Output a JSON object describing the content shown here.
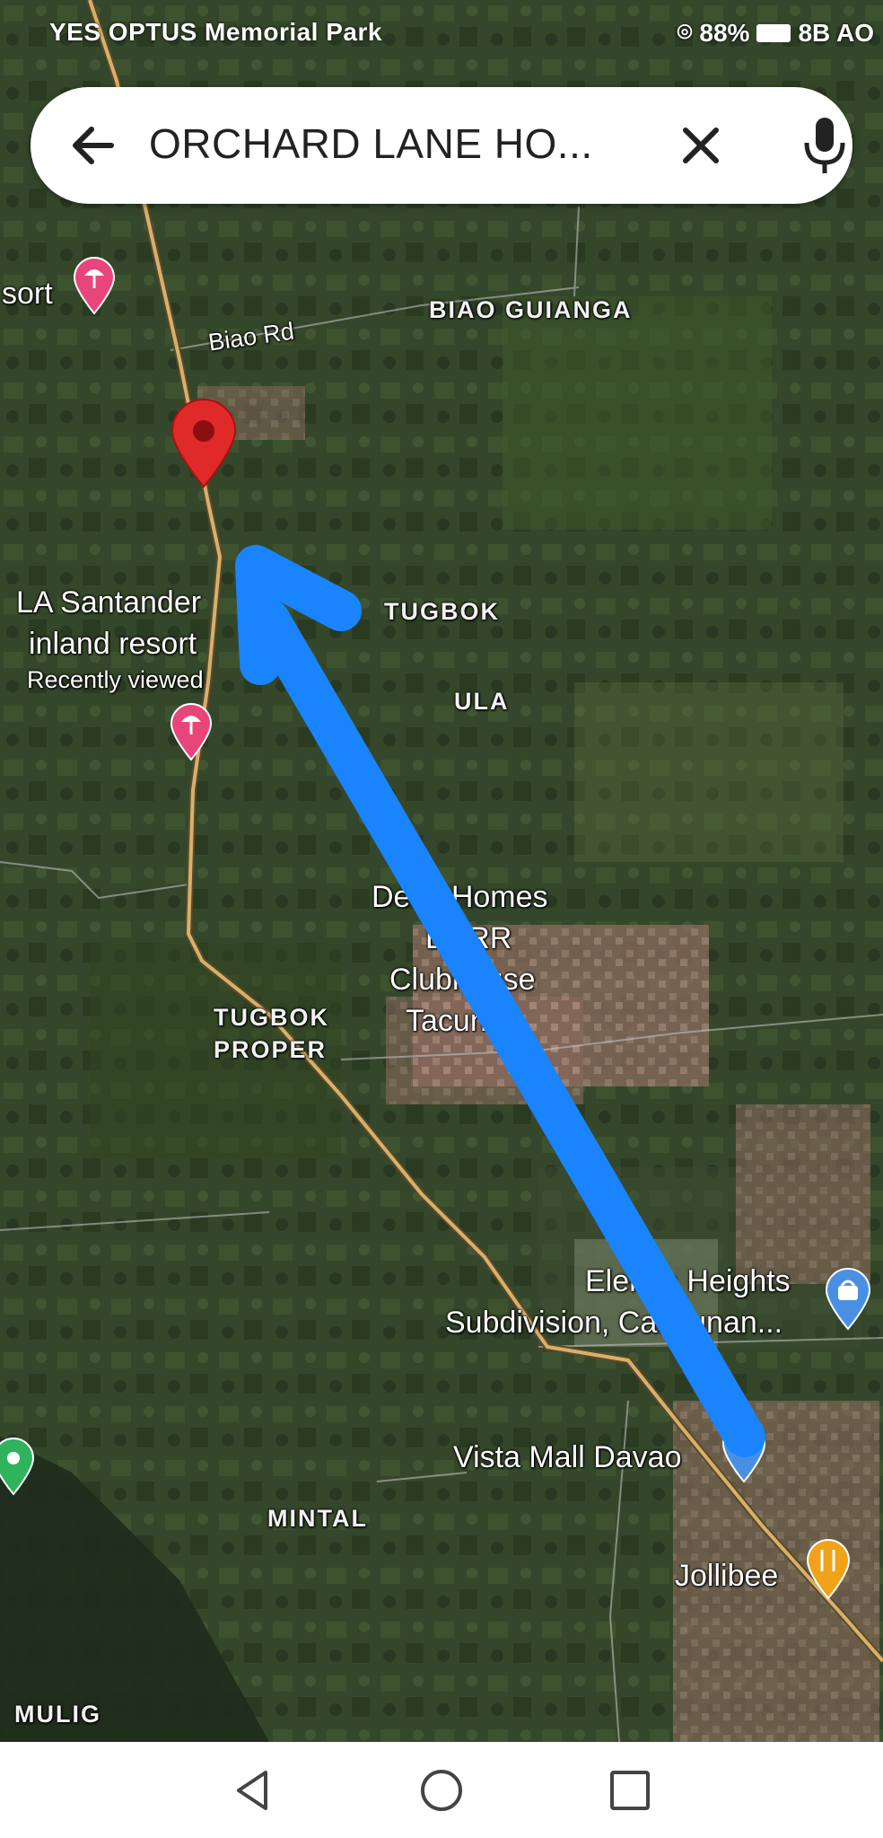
{
  "status_bar": {
    "left_text": "YES OPTUS  Memorial Park",
    "right_text": "88%",
    "right_extra": "8B AO"
  },
  "search": {
    "query": "ORCHARD LANE HO...",
    "icons": [
      "back-arrow-icon",
      "clear-icon",
      "microphone-icon"
    ]
  },
  "map": {
    "labels": {
      "resort_partial": "sort",
      "biao_rd": "Biao Rd",
      "biao_guianga": "BIAO GUIANGA",
      "la_santander_1": "LA Santander",
      "la_santander_2": "inland resort",
      "recently_viewed": "Recently viewed",
      "tugbok": "TUGBOK",
      "ula": "ULA",
      "deca_1": "Deca Homes",
      "deca_2": "DARR",
      "deca_3": "Clubhouse",
      "deca_4": "Tacunan",
      "tugbok_proper_1": "TUGBOK",
      "tugbok_proper_2": "PROPER",
      "elenita_1": "Elenita Heights",
      "elenita_2": "Subdivision, Catalunan...",
      "vista_mall": "Vista Mall Davao",
      "mintal": "MINTAL",
      "jollibee": "Jollibee",
      "mulig": "MULIG"
    },
    "arrow_color": "#1a84ff",
    "pin_color": "#e02a2a"
  },
  "nav_bar": {
    "buttons": [
      "back-triangle-icon",
      "home-circle-icon",
      "recents-square-icon"
    ]
  }
}
